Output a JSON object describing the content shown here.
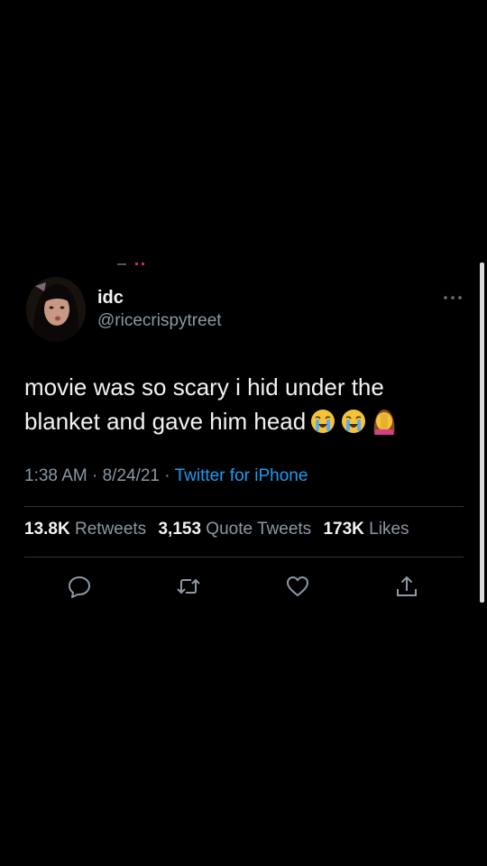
{
  "tweet": {
    "author": {
      "display_name": "idc",
      "handle": "@ricecrispytreet"
    },
    "text": "movie was so scary i hid under the blanket and gave him head",
    "emojis": [
      "loudly-crying-face-emoji",
      "loudly-crying-face-emoji",
      "woman-facepalming-emoji"
    ],
    "timestamp": {
      "time": "1:38 AM",
      "separator": " · ",
      "date": "8/24/21",
      "source": "Twitter for iPhone"
    },
    "stats": {
      "retweets_count": "13.8K",
      "retweets_label": "Retweets",
      "quotes_count": "3,153",
      "quotes_label": "Quote Tweets",
      "likes_count": "173K",
      "likes_label": "Likes"
    },
    "actions": [
      "reply-icon",
      "retweet-icon",
      "like-icon",
      "share-icon"
    ]
  },
  "colors": {
    "background": "#000000",
    "text_primary": "#e7e9ea",
    "text_secondary": "#8b98a5",
    "link": "#1d9bf0",
    "divider": "#2f3336"
  }
}
